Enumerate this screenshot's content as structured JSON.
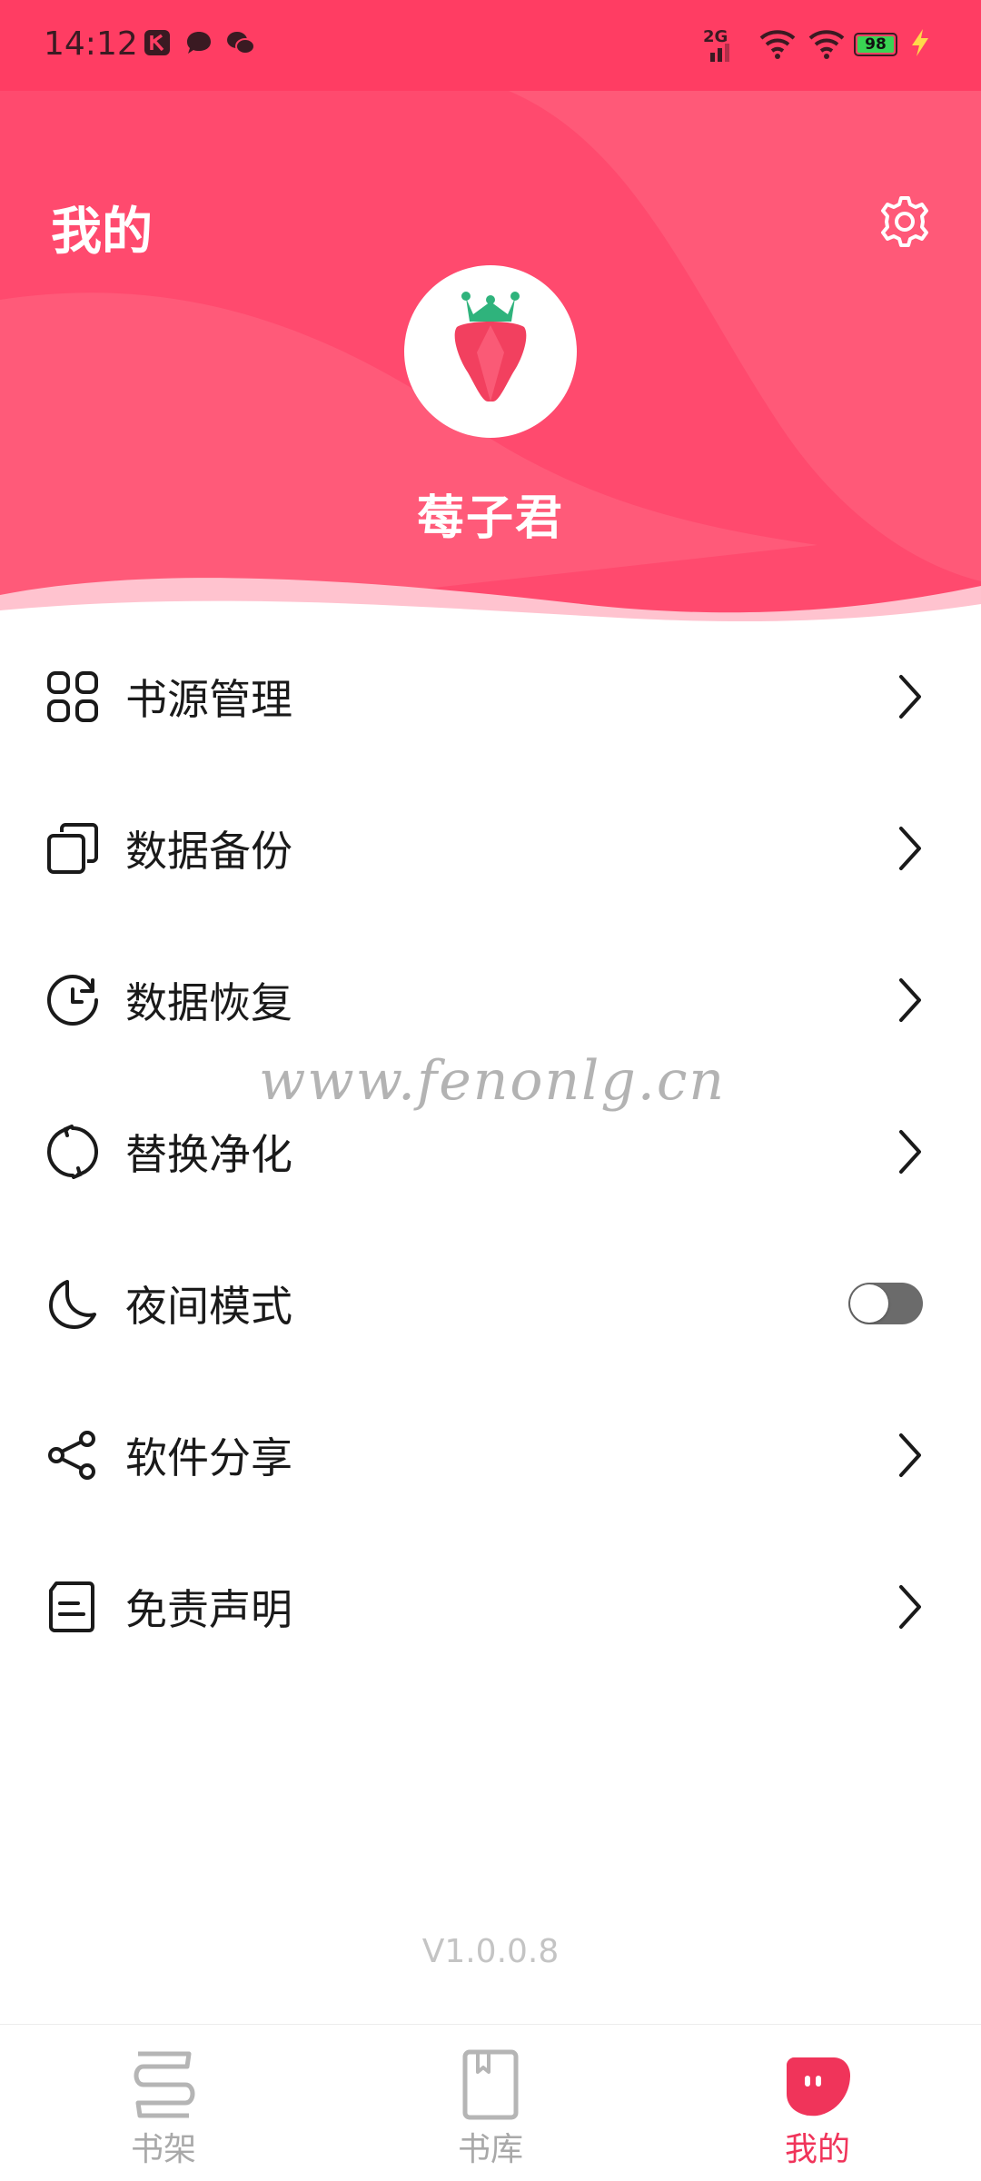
{
  "status_bar": {
    "time": "14:12",
    "network": "2G",
    "battery": "98",
    "icons": [
      "app-k-icon",
      "chat-bubble-icon",
      "wechat-icon",
      "signal-icon",
      "wifi-icon",
      "battery-icon",
      "charging-icon"
    ]
  },
  "header": {
    "title": "我的",
    "username": "莓子君",
    "accent_color": "#ff3d63"
  },
  "menu": {
    "items": [
      {
        "label": "书源管理",
        "icon": "grid-icon"
      },
      {
        "label": "数据备份",
        "icon": "copy-icon"
      },
      {
        "label": "数据恢复",
        "icon": "restore-clock-icon"
      },
      {
        "label": "替换净化",
        "icon": "sync-icon"
      },
      {
        "label": "夜间模式",
        "icon": "moon-icon",
        "toggle": false
      },
      {
        "label": "软件分享",
        "icon": "share-icon"
      },
      {
        "label": "免责声明",
        "icon": "document-icon"
      }
    ]
  },
  "watermark": "www.fenonlg.cn",
  "version": "V1.0.0.8",
  "bottom_nav": {
    "items": [
      {
        "label": "书架",
        "icon": "bookshelf-icon",
        "active": false
      },
      {
        "label": "书库",
        "icon": "library-book-icon",
        "active": false
      },
      {
        "label": "我的",
        "icon": "profile-icon",
        "active": true
      }
    ],
    "active_color": "#f0345a"
  }
}
